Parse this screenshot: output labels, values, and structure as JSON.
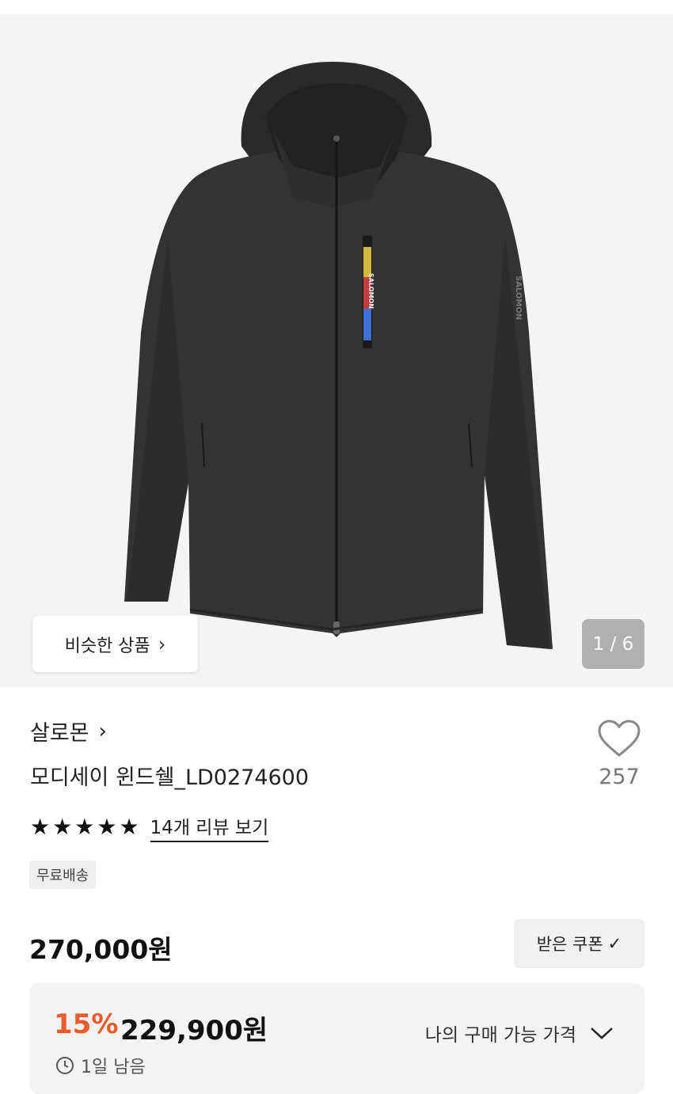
{
  "hero": {
    "similar_button": "비슷한 상품",
    "image_counter": "1 / 6",
    "jacket_print_chest": "SALOMON",
    "jacket_print_sleeve": "SALOMON"
  },
  "product": {
    "brand": "살로몬",
    "name": "모디세이 윈드쉘_LD0274600",
    "likes": "257",
    "rating_stars": 5,
    "review_link": "14개 리뷰 보기",
    "badge": "무료배송",
    "price": "270,000원",
    "coupon_button": "받은 쿠폰"
  },
  "sale": {
    "discount": "15%",
    "price": "229,900원",
    "remaining": "1일 남음",
    "my_price_label": "나의 구매 가능 가격"
  },
  "colors": {
    "discount": "#ef5a2a",
    "jacket": "#303030",
    "background": "#f4f4f4"
  }
}
